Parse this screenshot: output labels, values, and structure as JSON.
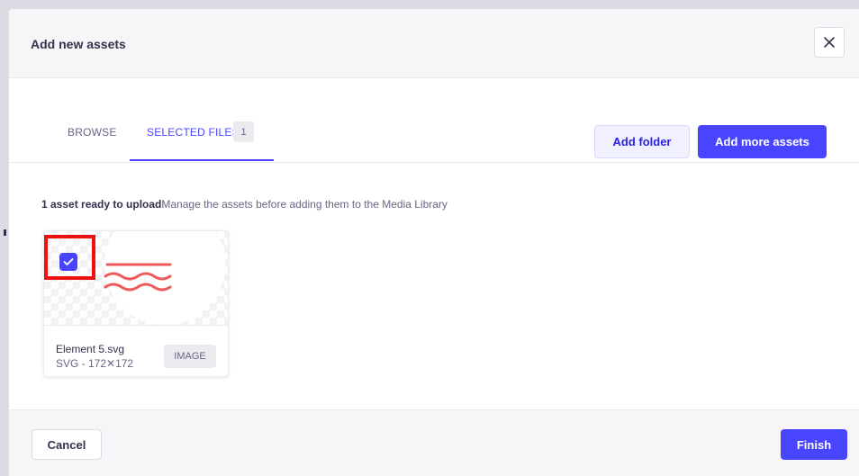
{
  "modal": {
    "title": "Add new assets",
    "close_icon": "close-icon"
  },
  "tabs": [
    {
      "label": "BROWSE",
      "active": false
    },
    {
      "label": "SELECTED FILES",
      "active": true,
      "count": "1"
    }
  ],
  "actions": {
    "add_folder": "Add folder",
    "add_more_assets": "Add more assets"
  },
  "summary": {
    "ready": "1 asset ready to upload",
    "hint": "Manage the assets before adding them to the Media Library"
  },
  "asset": {
    "name": "Element 5.svg",
    "meta": "SVG - 172✕172",
    "type_badge": "IMAGE",
    "selected": true,
    "checkbox_icon": "checkmark-icon"
  },
  "footer": {
    "cancel": "Cancel",
    "finish": "Finish"
  },
  "colors": {
    "primary": "#4945ff",
    "highlight": "#ee1111",
    "thumbnail_wave": "#ee5a5a"
  }
}
